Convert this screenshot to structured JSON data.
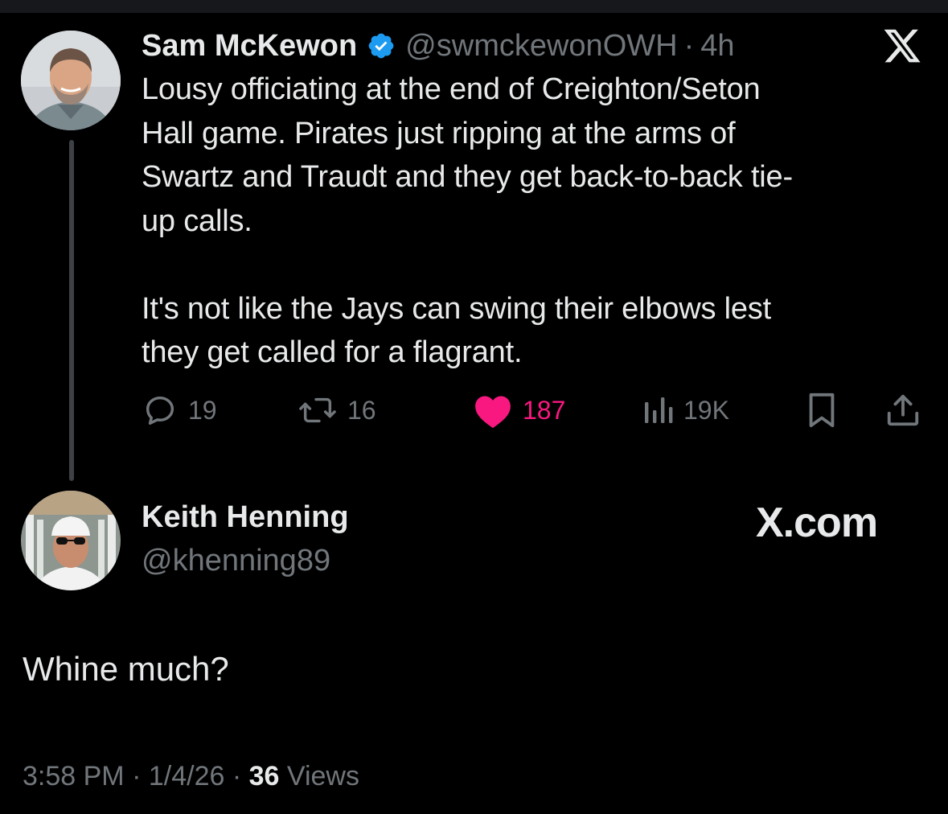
{
  "quoted_tweet": {
    "author_name": "Sam McKewon",
    "handle": "@swmckewonOWH",
    "separator": "·",
    "time_ago": "4h",
    "text": "Lousy officiating at the end of Creighton/Seton\nHall game. Pirates just ripping at the arms of\nSwartz and Traudt and they get back-to-back tie-\nup calls.\n\nIt's not like the Jays can swing their elbows lest\nthey get called for a flagrant.",
    "replies": "19",
    "reposts": "16",
    "likes": "187",
    "views": "19K",
    "icons": [
      "reply-icon",
      "repost-icon",
      "like-icon",
      "views-icon",
      "bookmark-icon",
      "share-icon",
      "verified-badge-icon",
      "x-logo-icon"
    ]
  },
  "reply": {
    "author_name": "Keith Henning",
    "handle": "@khenning89",
    "text": "Whine much?",
    "time": "3:58 PM",
    "sep1": "·",
    "date": "1/4/26",
    "sep2": "·",
    "views_count": "36",
    "views_label": "Views"
  },
  "watermark": "X.com",
  "colors": {
    "background": "#000000",
    "primary_text": "#e7e9ea",
    "secondary_text": "#71767b",
    "like_pink": "#f91880",
    "verified_blue": "#1d9bf0"
  }
}
